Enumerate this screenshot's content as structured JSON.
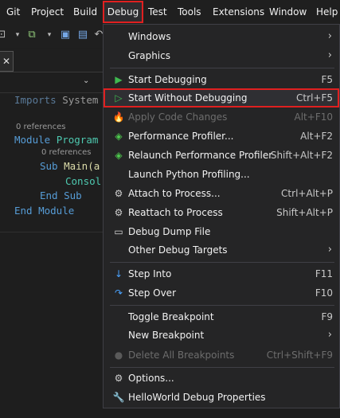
{
  "menubar": {
    "items": [
      "Git",
      "Project",
      "Build",
      "Debug",
      "Test",
      "Tools",
      "Extensions",
      "Window",
      "Help"
    ]
  },
  "toolbar": {
    "icons": [
      "new-item-icon",
      "chevron-down-icon",
      "add-item-icon",
      "chevron-down-icon",
      "save-icon",
      "save-all-icon",
      "undo-icon"
    ]
  },
  "code": {
    "line1": [
      "Imports",
      "System"
    ],
    "refs1": "0 references",
    "line2": [
      "Module",
      "Program"
    ],
    "refs2": "0 references",
    "line3": [
      "Sub",
      "Main(a"
    ],
    "line4": "Consol",
    "line5": [
      "End",
      "Sub"
    ],
    "line6": [
      "End",
      "Module"
    ]
  },
  "debug_menu": {
    "items": [
      {
        "label": "Windows",
        "submenu": true
      },
      {
        "label": "Graphics",
        "submenu": true
      },
      {
        "label": "Start Debugging",
        "shortcut": "F5",
        "icon": "play-filled-icon"
      },
      {
        "label": "Start Without Debugging",
        "shortcut": "Ctrl+F5",
        "icon": "play-outline-icon"
      },
      {
        "label": "Apply Code Changes",
        "shortcut": "Alt+F10",
        "icon": "hot-reload-icon",
        "disabled": true
      },
      {
        "label": "Performance Profiler...",
        "shortcut": "Alt+F2",
        "icon": "profiler-icon"
      },
      {
        "label": "Relaunch Performance Profiler",
        "shortcut": "Shift+Alt+F2",
        "icon": "relaunch-profiler-icon"
      },
      {
        "label": "Launch Python Profiling..."
      },
      {
        "label": "Attach to Process...",
        "shortcut": "Ctrl+Alt+P",
        "icon": "attach-process-icon"
      },
      {
        "label": "Reattach to Process",
        "shortcut": "Shift+Alt+P",
        "icon": "reattach-process-icon"
      },
      {
        "label": "Debug Dump File",
        "icon": "dump-file-icon"
      },
      {
        "label": "Other Debug Targets",
        "submenu": true
      },
      {
        "label": "Step Into",
        "shortcut": "F11",
        "icon": "step-into-icon"
      },
      {
        "label": "Step Over",
        "shortcut": "F10",
        "icon": "step-over-icon"
      },
      {
        "label": "Toggle Breakpoint",
        "shortcut": "F9"
      },
      {
        "label": "New Breakpoint",
        "submenu": true
      },
      {
        "label": "Delete All Breakpoints",
        "shortcut": "Ctrl+Shift+F9",
        "icon": "delete-breakpoints-icon",
        "disabled": true
      },
      {
        "label": "Options...",
        "icon": "gear-icon"
      },
      {
        "label": "HelloWorld Debug Properties",
        "icon": "wrench-icon"
      }
    ]
  },
  "colors": {
    "highlight": "#e02020",
    "play_green": "#3fb950",
    "keyword": "#569cd6",
    "type": "#4ec9b0"
  }
}
